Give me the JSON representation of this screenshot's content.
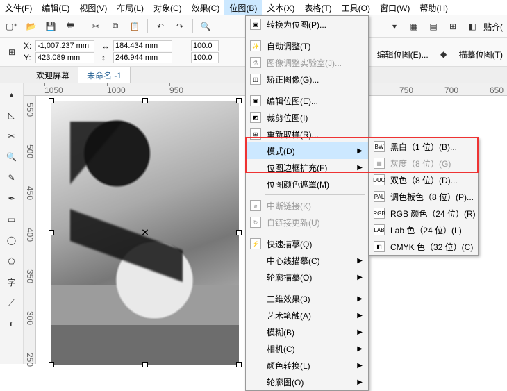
{
  "menu": {
    "file": "文件(F)",
    "edit": "编辑(E)",
    "view": "视图(V)",
    "layout": "布局(L)",
    "object": "对象(C)",
    "effects": "效果(C)",
    "bitmap": "位图(B)",
    "text": "文本(X)",
    "table": "表格(T)",
    "tools": "工具(O)",
    "window": "窗口(W)",
    "help": "帮助(H)"
  },
  "coords": {
    "x": "-1,007.237 mm",
    "y": "423.089 mm",
    "w": "184.434 mm",
    "h": "246.944 mm",
    "sx": "100.0",
    "sy": "100.0"
  },
  "tabs": {
    "welcome": "欢迎屏幕",
    "doc": "未命名 -1"
  },
  "ruler": {
    "m1050": "1050",
    "m1000": "1000",
    "m950": "950",
    "r750": "750",
    "r700": "700",
    "r650": "650",
    "v550": "550",
    "v500": "500",
    "v450": "450",
    "v400": "400",
    "v350": "350",
    "v300": "300",
    "v250": "250"
  },
  "right": {
    "paste": "贴齐(",
    "editbmp": "编辑位图(E)...",
    "trace": "描摹位图(T)"
  },
  "bm": {
    "convert": "转换为位图(P)...",
    "auto": "自动调整(T)",
    "lab": "图像调整实验室(J)...",
    "straighten": "矫正图像(G)...",
    "edit": "编辑位图(E)...",
    "crop": "裁剪位图(I)",
    "resample": "重新取样(R)...",
    "mode": "模式(D)",
    "inflate": "位图边框扩充(F)",
    "mask": "位图颜色遮罩(M)",
    "break": "中断链接(K)",
    "update": "自链接更新(U)",
    "qtrace": "快速描摹(Q)",
    "ctrace": "中心线描摹(C)",
    "otrace": "轮廓描摹(O)",
    "d3": "三维效果(3)",
    "art": "艺术笔触(A)",
    "blur": "模糊(B)",
    "camera": "相机(C)",
    "colorx": "颜色转换(L)",
    "contour": "轮廓图(O)"
  },
  "mode": {
    "bw": "黑白（1 位）(B)...",
    "gray": "灰度（8 位）(G)",
    "duo": "双色（8 位）(D)...",
    "pal": "调色板色（8 位）(P)...",
    "rgb": "RGB 颜色（24 位）(R)",
    "lab": "Lab 色（24 位）(L)",
    "cmyk": "CMYK 色（32 位）(C)"
  },
  "modeicons": {
    "bw": "BW",
    "gray": "▦",
    "duo": "DUO",
    "pal": "PAL",
    "rgb": "RGB",
    "lab": "LAB",
    "cmyk": "◧"
  }
}
